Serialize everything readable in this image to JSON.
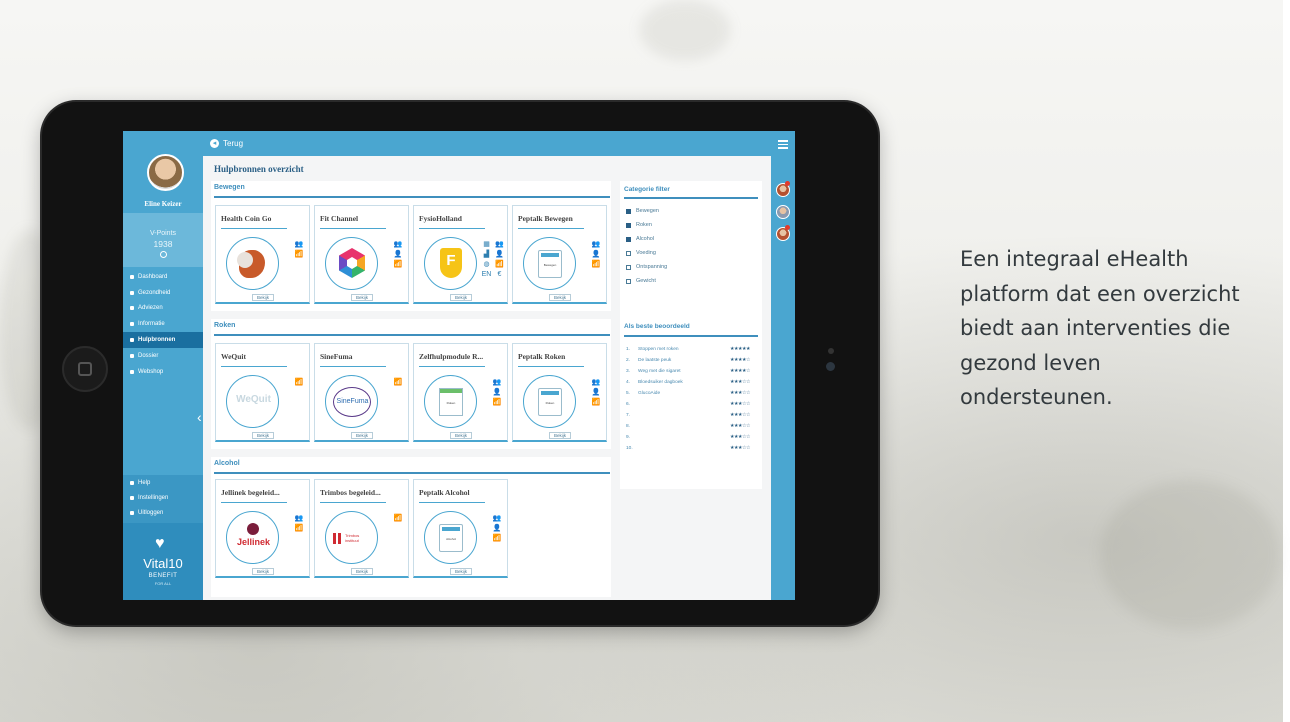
{
  "tagline": "Een integraal eHealth platform dat een overzicht biedt aan interventies die gezond leven ondersteunen.",
  "sidebar": {
    "user_name": "Eline Keizer",
    "vpoints_label": "V-Points",
    "vpoints_value": "1938",
    "nav": [
      "Dashboard",
      "Gezondheid",
      "Adviezen",
      "Informatie",
      "Hulpbronnen",
      "Dossier",
      "Webshop"
    ],
    "active_nav": "Hulpbronnen",
    "bottom_nav": [
      "Help",
      "Instellingen",
      "Uitloggen"
    ],
    "brand_name": "Vital10",
    "brand_sub": "BENEFIT",
    "brand_sub2": "FOR ALL"
  },
  "topbar": {
    "back_label": "Terug"
  },
  "page_title": "Hulpbronnen overzicht",
  "sections": [
    {
      "title": "Bewegen",
      "cards": [
        {
          "title": "Health Coin Go",
          "button": "Bekijk",
          "icons": [
            "people-icon",
            "wifi-icon"
          ]
        },
        {
          "title": "Fit Channel",
          "button": "Bekijk",
          "icons": [
            "people-icon",
            "person-icon",
            "wifi-icon"
          ]
        },
        {
          "title": "FysioHolland",
          "button": "Bekijk",
          "icons": [
            "calculator-icon",
            "people-icon",
            "signal-icon",
            "person-icon",
            "globe-icon",
            "wifi-icon",
            "EN",
            "€"
          ]
        },
        {
          "title": "Peptalk Bewegen",
          "button": "Bekijk",
          "logo_text": "Bewegen",
          "icons": [
            "people-icon",
            "person-icon",
            "wifi-icon"
          ]
        }
      ]
    },
    {
      "title": "Roken",
      "cards": [
        {
          "title": "WeQuit",
          "button": "Bekijk",
          "logo_text": "WeQuit",
          "icons": [
            "wifi-icon"
          ]
        },
        {
          "title": "SineFuma",
          "button": "Bekijk",
          "logo_text": "SineFuma",
          "icons": [
            "wifi-icon"
          ]
        },
        {
          "title": "Zelfhulpmodule R...",
          "button": "Bekijk",
          "logo_text": "Roken",
          "icons": [
            "people-icon",
            "person-icon",
            "wifi-icon"
          ]
        },
        {
          "title": "Peptalk Roken",
          "button": "Bekijk",
          "logo_text": "Roken",
          "icons": [
            "people-icon",
            "person-icon",
            "wifi-icon"
          ]
        }
      ]
    },
    {
      "title": "Alcohol",
      "cards": [
        {
          "title": "Jellinek begeleid...",
          "button": "Bekijk",
          "logo_text": "Jellinek",
          "icons": [
            "people-icon",
            "wifi-icon"
          ]
        },
        {
          "title": "Trimbos begeleid...",
          "button": "Bekijk",
          "logo_text": "Trimbos instituut",
          "icons": [
            "wifi-icon"
          ]
        },
        {
          "title": "Peptalk Alcohol",
          "button": "Bekijk",
          "logo_text": "Alcohol",
          "icons": [
            "people-icon",
            "person-icon",
            "wifi-icon"
          ]
        }
      ]
    }
  ],
  "category_filter": {
    "title": "Categorie filter",
    "items": [
      {
        "label": "Bewegen",
        "checked": true
      },
      {
        "label": "Roken",
        "checked": true
      },
      {
        "label": "Alcohol",
        "checked": true
      },
      {
        "label": "Voeding",
        "checked": false
      },
      {
        "label": "Ontspanning",
        "checked": false
      },
      {
        "label": "Gewicht",
        "checked": false
      }
    ]
  },
  "top_rated": {
    "title": "Als beste beoordeeld",
    "items": [
      {
        "num": "1.",
        "name": "Stoppen met roken",
        "stars": "★★★★★"
      },
      {
        "num": "2.",
        "name": "De laatste peuk",
        "stars": "★★★★☆"
      },
      {
        "num": "3.",
        "name": "Weg met die sigaret",
        "stars": "★★★★☆"
      },
      {
        "num": "4.",
        "name": "Bloedsuiker dagboek",
        "stars": "★★★☆☆"
      },
      {
        "num": "5.",
        "name": "GlucoAide",
        "stars": "★★★☆☆"
      },
      {
        "num": "6.",
        "name": "",
        "stars": "★★★☆☆"
      },
      {
        "num": "7.",
        "name": "",
        "stars": "★★★☆☆"
      },
      {
        "num": "8.",
        "name": "",
        "stars": "★★★☆☆"
      },
      {
        "num": "9.",
        "name": "",
        "stars": "★★★☆☆"
      },
      {
        "num": "10.",
        "name": "",
        "stars": "★★★☆☆"
      }
    ]
  },
  "colors": {
    "primary": "#4aa6d0",
    "active": "#1a6fa0",
    "title": "#2a5f85"
  }
}
